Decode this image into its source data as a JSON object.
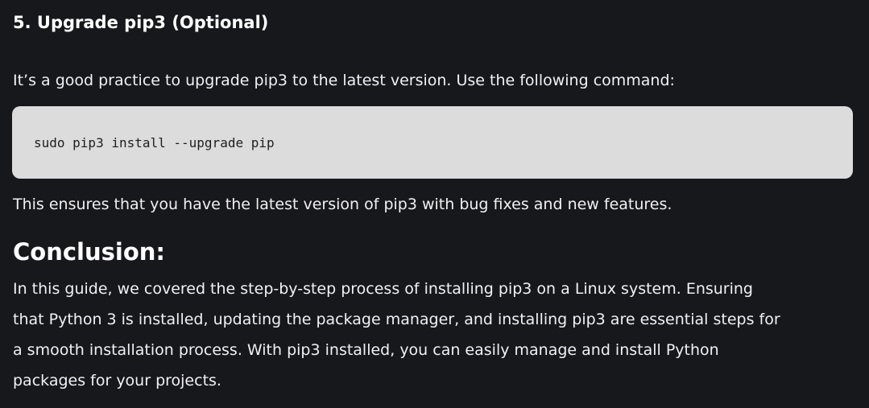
{
  "section": {
    "heading": "5. Upgrade pip3 (Optional)",
    "intro": "It’s a good practice to upgrade pip3 to the latest version. Use the following command:",
    "code": "sudo pip3 install --upgrade pip",
    "after": "This ensures that you have the latest version of pip3 with bug fixes and new features."
  },
  "conclusion": {
    "heading": "Conclusion:",
    "lines": [
      "In this guide, we covered the step-by-step process of installing pip3 on a Linux system. Ensuring",
      "that Python 3 is installed, updating the package manager, and installing pip3 are essential steps for",
      "a smooth installation process. With pip3 installed, you can easily manage and install Python",
      "packages for your projects."
    ]
  },
  "colors": {
    "background": "#17181c",
    "text": "#f1f1f1",
    "code_background": "#dcdcdc",
    "code_text": "#1e1e1e"
  }
}
